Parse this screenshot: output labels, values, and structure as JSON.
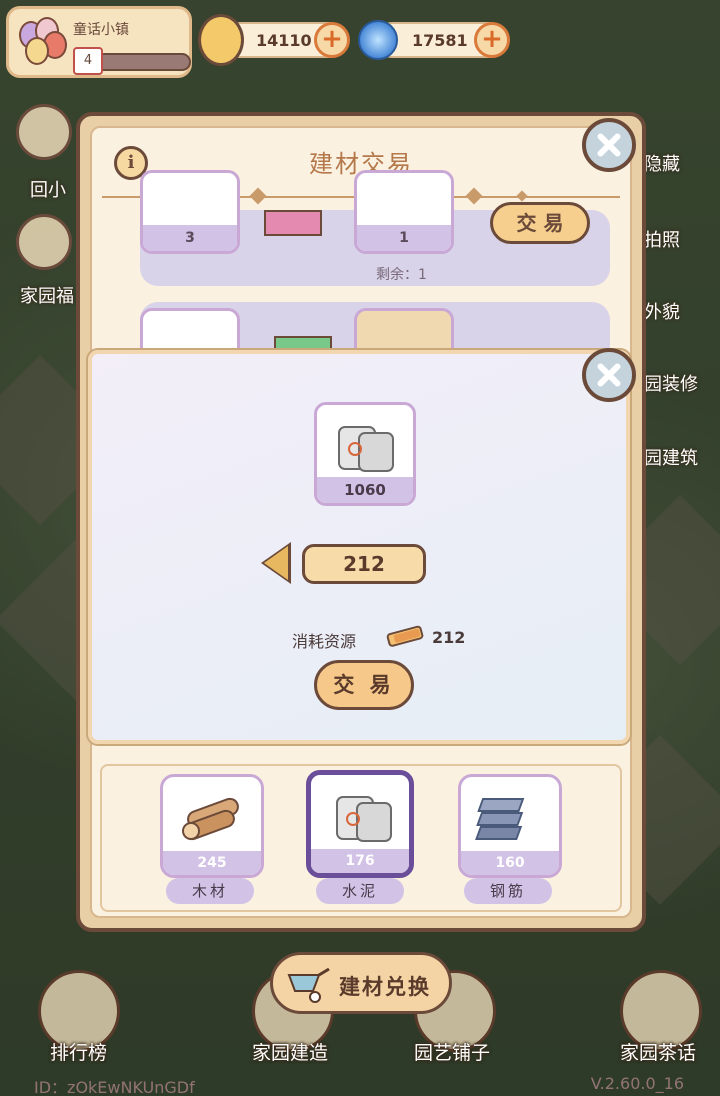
{
  "hud": {
    "town_name": "童话小镇",
    "level": "4",
    "level_progress": 0.15,
    "currency1": "14110",
    "currency2": "17581",
    "plus": "+"
  },
  "side_left": [
    "回小",
    "家园福"
  ],
  "side_right": [
    "隐藏",
    "拍照",
    "外貌",
    "园装修",
    "园建筑"
  ],
  "panel": {
    "title": "建材交易",
    "info": "i",
    "row1": {
      "give_count": "3",
      "get_count": "1",
      "remain": "剩余：1",
      "trade_label": "交 易"
    }
  },
  "dialog": {
    "item_count": "1060",
    "quantity": "212",
    "cost_label": "消耗资源",
    "cost_value": "212",
    "trade_label": "交 易"
  },
  "materials": [
    {
      "count": "245",
      "label": "木材"
    },
    {
      "count": "176",
      "label": "水泥"
    },
    {
      "count": "160",
      "label": "钢筋"
    }
  ],
  "bottom_nav": {
    "leaderboard": "排行榜",
    "build": "家园建造",
    "shop": "园艺铺子",
    "tea": "家园茶话",
    "exchange": "建材兑换"
  },
  "footer": {
    "id": "ID：zOkEwNKUnGDf",
    "version": "V.2.60.0_16"
  },
  "icons": {
    "balloons": "balloons-icon",
    "coin": "snail-coin-icon",
    "swirl": "blue-swirl-icon",
    "cement": "cement-bag-icon",
    "wood": "wood-logs-icon",
    "steel": "steel-beams-icon",
    "bread": "bread-icon",
    "close": "close-icon"
  },
  "colors": {
    "panel_border": "#6b4a3a",
    "card_footer": "#d2c2e6",
    "selected_card": "#6a4e9a",
    "plus_accent": "#d97a3a"
  }
}
